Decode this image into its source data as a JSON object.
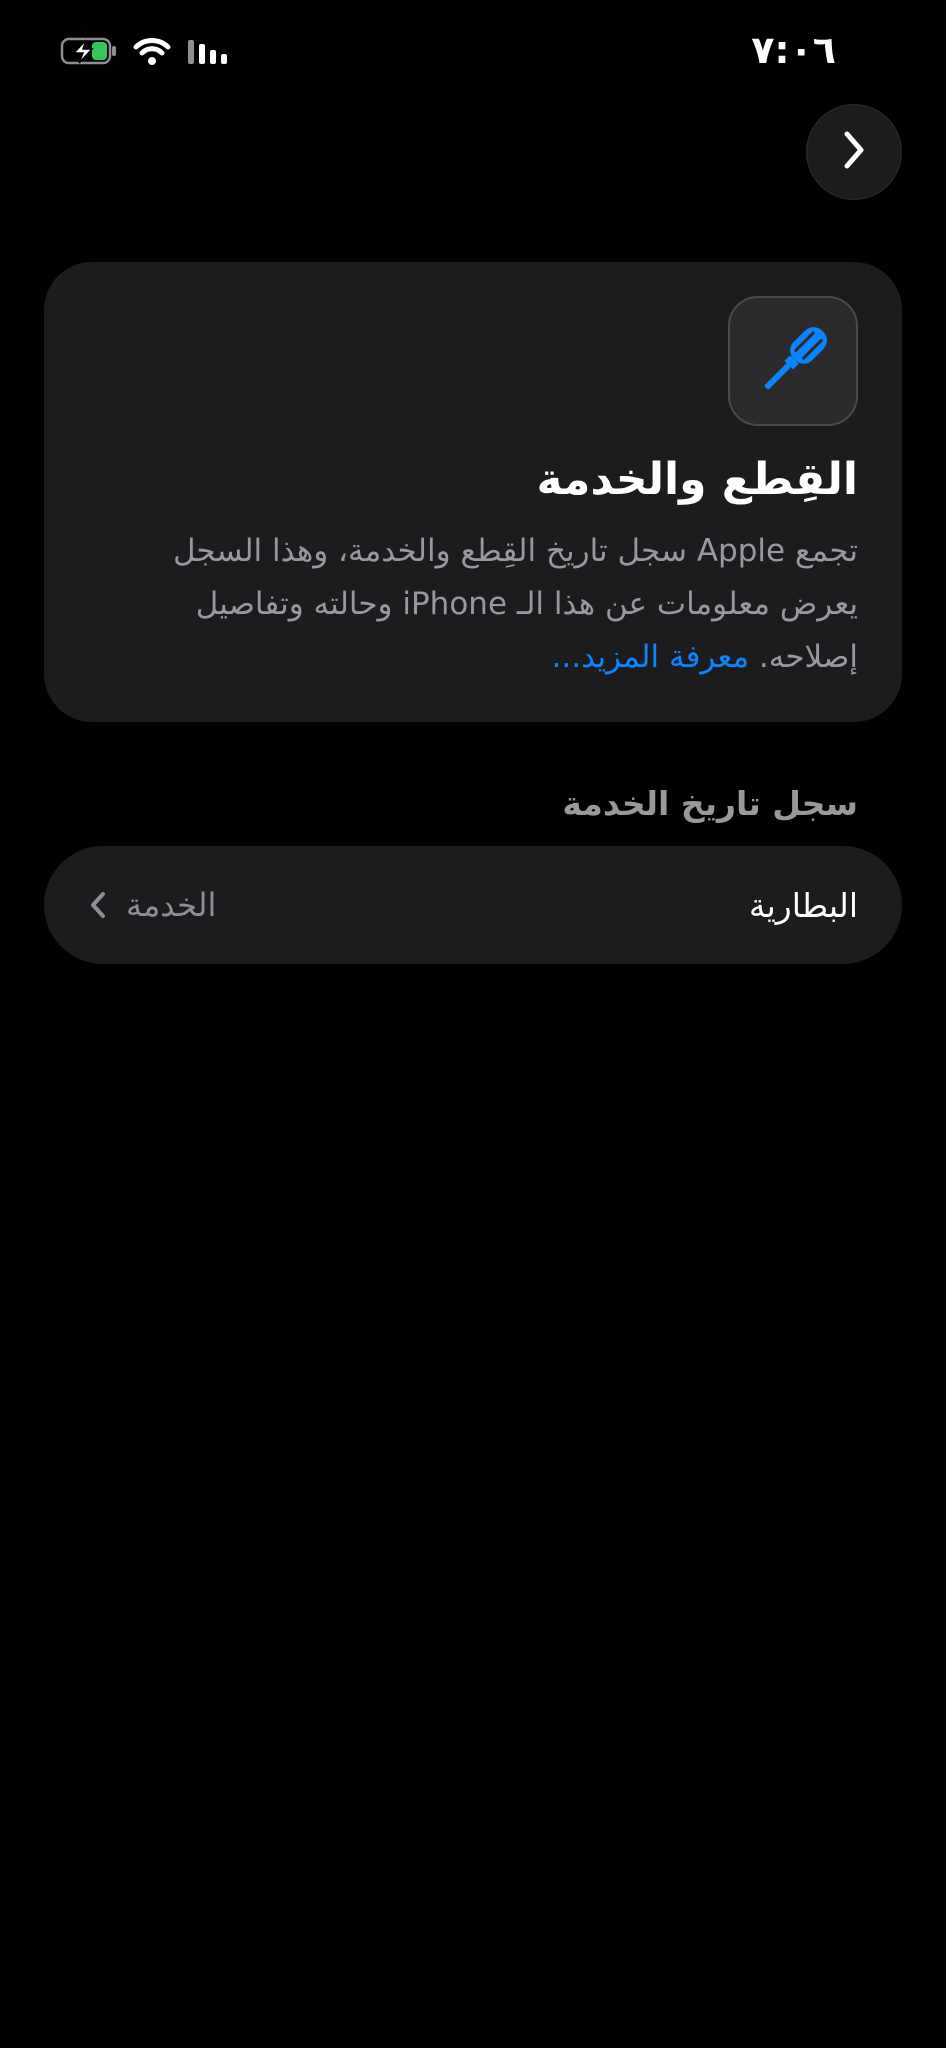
{
  "status_bar": {
    "time": "٧:٠٦",
    "icons": [
      "battery-charging-icon",
      "wifi-icon",
      "cellular-signal-icon"
    ],
    "battery_color": "#34c759"
  },
  "nav": {
    "forward_icon": "chevron-right-icon"
  },
  "info_card": {
    "icon": "screwdriver-icon",
    "icon_color": "#0a84ff",
    "title": "القِطع والخدمة",
    "body": "تجمع Apple سجل تاريخ القِطع والخدمة، وهذا السجل يعرض معلومات عن هذا الـ iPhone وحالته وتفاصيل إصلاحه.",
    "learn_more": "معرفة المزيد..."
  },
  "section": {
    "header": "سجل تاريخ الخدمة"
  },
  "rows": [
    {
      "label": "البطارية",
      "value": "الخدمة",
      "icon": "chevron-left-icon"
    }
  ],
  "colors": {
    "background": "#000000",
    "card": "#1c1c1e",
    "secondary_text": "#98989d",
    "link": "#0a84ff"
  }
}
